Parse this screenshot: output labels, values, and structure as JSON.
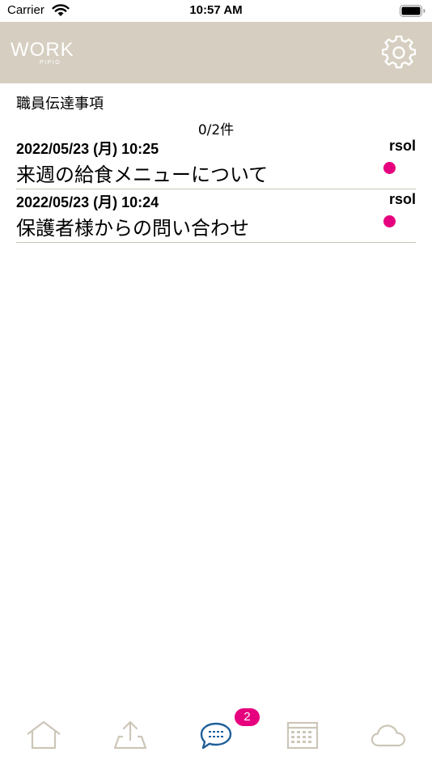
{
  "status_bar": {
    "carrier": "Carrier",
    "time": "10:57 AM"
  },
  "header": {
    "logo_text": "WORK",
    "logo_subtext": "PIPIO",
    "settings_icon": "gear-icon",
    "background_color": "#d6cfc1"
  },
  "main": {
    "section_title": "職員伝達事項",
    "count": "0/2件",
    "messages": [
      {
        "date": "2022/05/23 (月) 10:25",
        "sender": "rsol",
        "title": "来週の給食メニューについて",
        "unread": true
      },
      {
        "date": "2022/05/23 (月) 10:24",
        "sender": "rsol",
        "title": "保護者様からの問い合わせ",
        "unread": true
      }
    ]
  },
  "tab_bar": {
    "tabs": [
      {
        "icon": "home-icon"
      },
      {
        "icon": "upload-icon"
      },
      {
        "icon": "chat-icon",
        "active": true
      },
      {
        "icon": "calendar-icon"
      },
      {
        "icon": "cloud-icon"
      }
    ],
    "messages_badge": "2"
  },
  "colors": {
    "accent": "#e6007e",
    "active_tab": "#1f5f99",
    "inactive_tab": "#cdc6b8"
  }
}
